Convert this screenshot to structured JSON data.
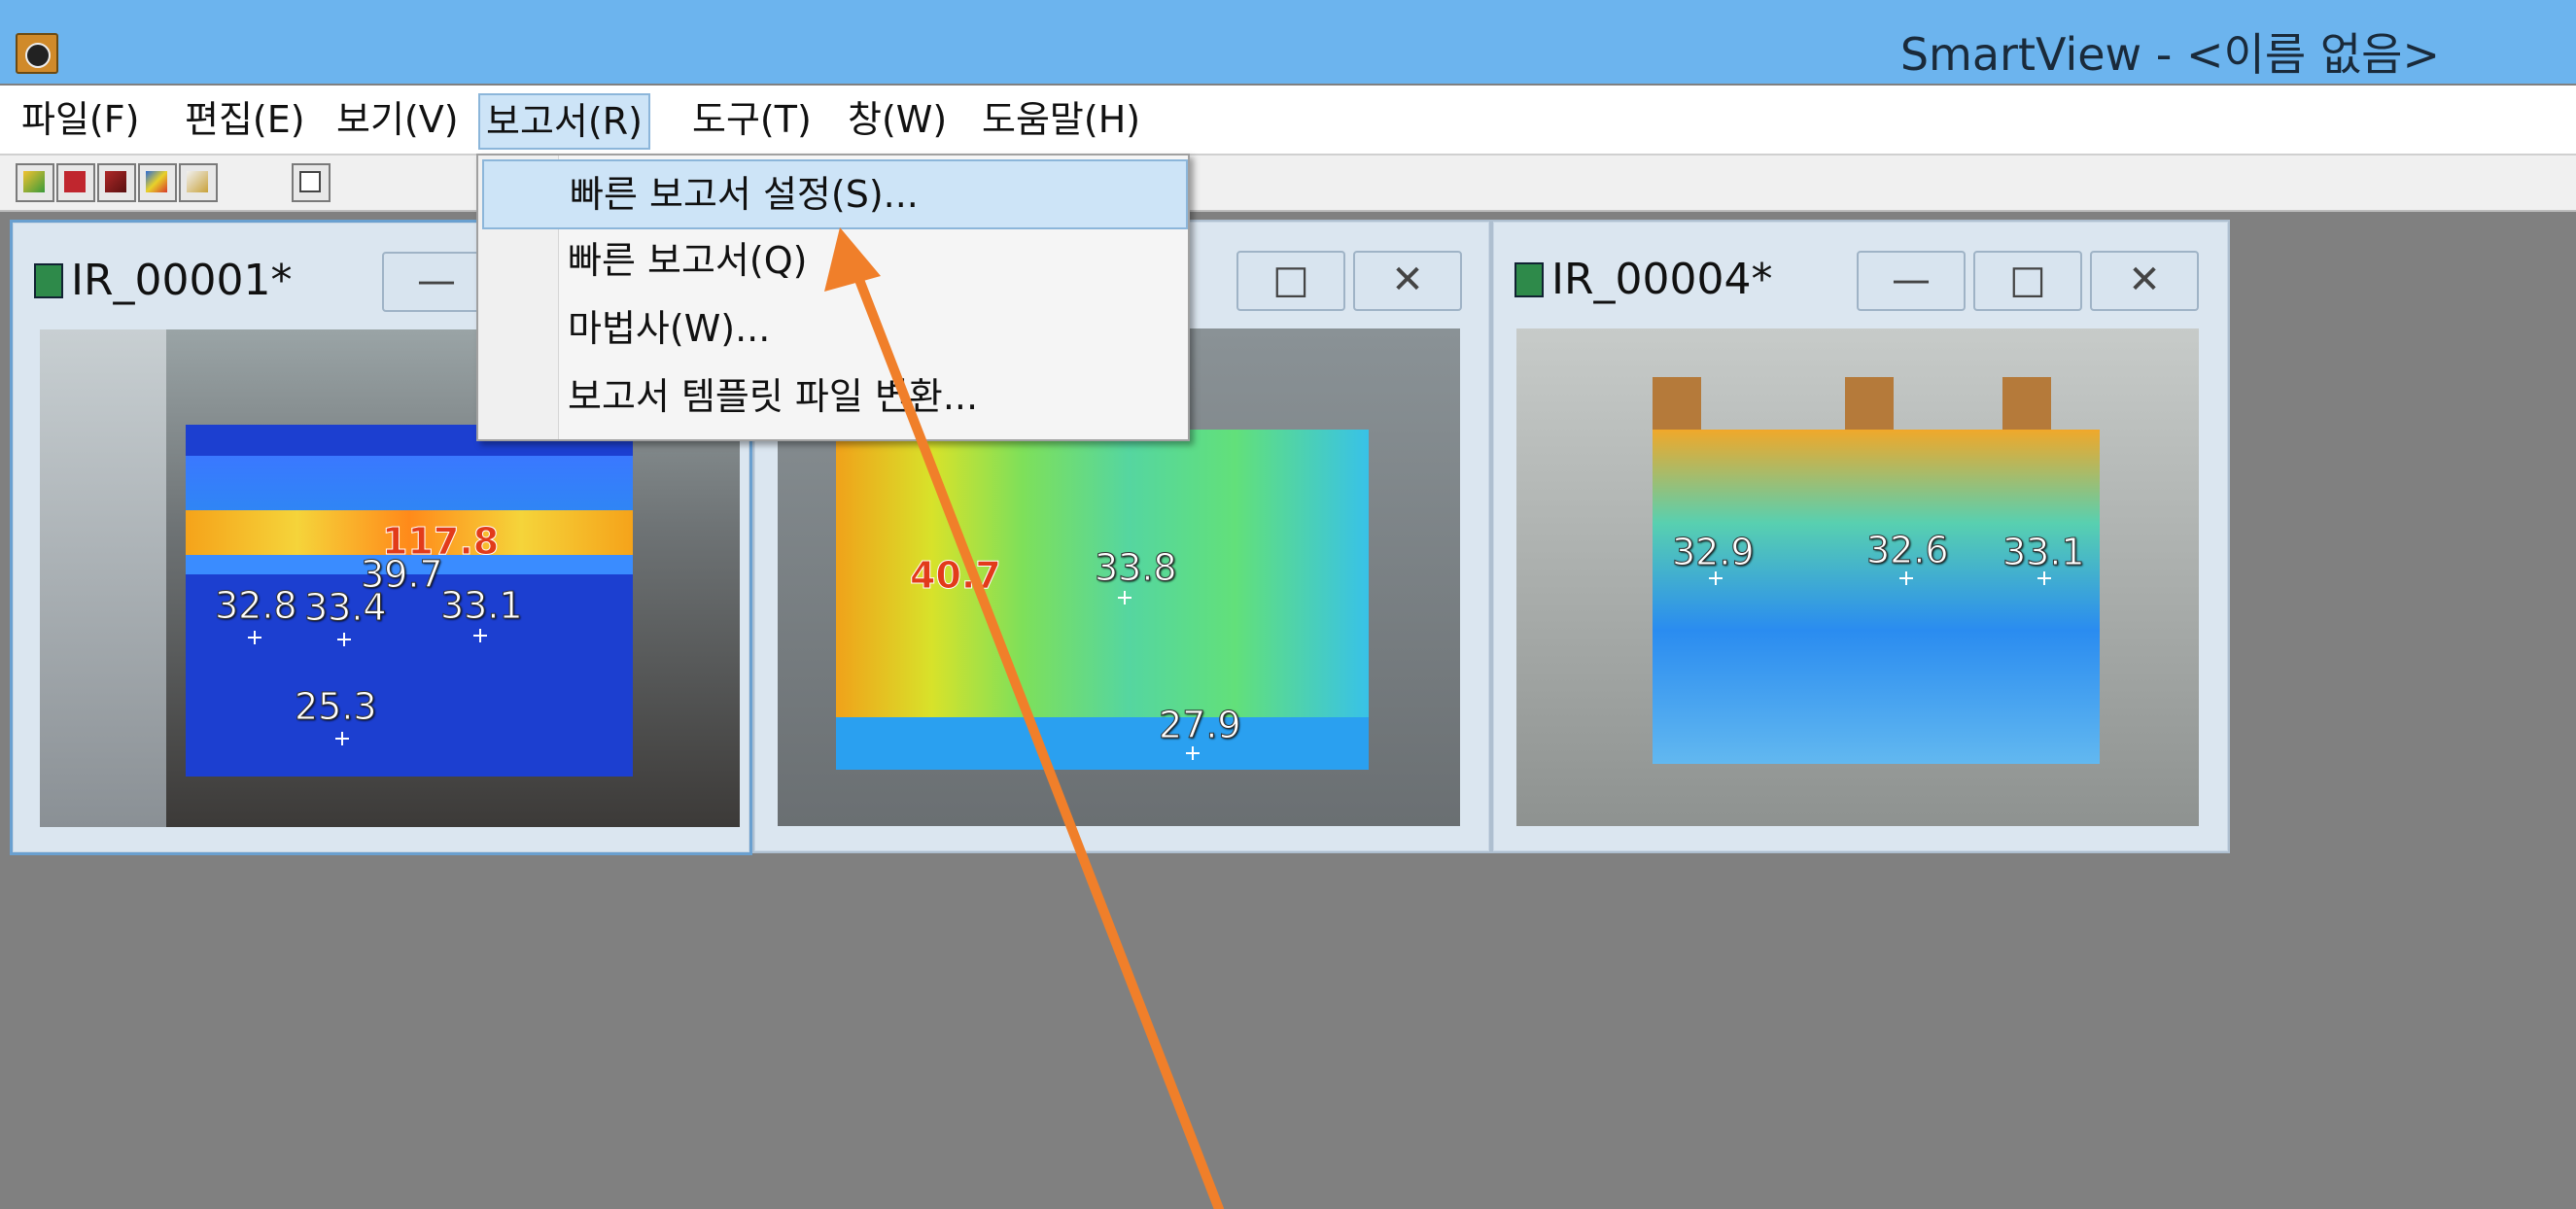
{
  "window": {
    "title": "SmartView - <이름 없음>",
    "app_icon": "camera-icon"
  },
  "menubar": {
    "items": [
      {
        "label": "파일(F)"
      },
      {
        "label": "편집(E)"
      },
      {
        "label": "보기(V)"
      },
      {
        "label": "보고서(R)",
        "active": true
      },
      {
        "label": "도구(T)"
      },
      {
        "label": "창(W)"
      },
      {
        "label": "도움말(H)"
      }
    ]
  },
  "toolbar": {
    "buttons": [
      "open-icon",
      "save-icon",
      "import-icon",
      "palette-icon",
      "edit-icon",
      "print-icon"
    ]
  },
  "report_menu": {
    "items": [
      {
        "label": "빠른 보고서 설정(S)...",
        "highlighted": true
      },
      {
        "label": "빠른 보고서(Q)"
      },
      {
        "label": "마법사(W)..."
      },
      {
        "label": "보고서 템플릿 파일 변환..."
      }
    ]
  },
  "child_windows": [
    {
      "title": "IR_00001*",
      "spots": [
        "117.8",
        "39.7",
        "32.8",
        "33.4",
        "33.1",
        "25.3"
      ],
      "hot_spot": "117.8"
    },
    {
      "title": "",
      "spots": [
        "40.7",
        "33.8",
        "27.9"
      ],
      "hot_spot": "40.7"
    },
    {
      "title": "IR_00004*",
      "spots": [
        "32.9",
        "32.6",
        "33.1"
      ]
    }
  ],
  "window_buttons": {
    "minimize": "—",
    "maximize": "□",
    "close": "✕"
  },
  "colors": {
    "titlebar": "#6cb4ee",
    "mdi_background": "#808080",
    "menu_highlight": "#cde4f7",
    "annotation_arrow": "#f07f2a"
  }
}
